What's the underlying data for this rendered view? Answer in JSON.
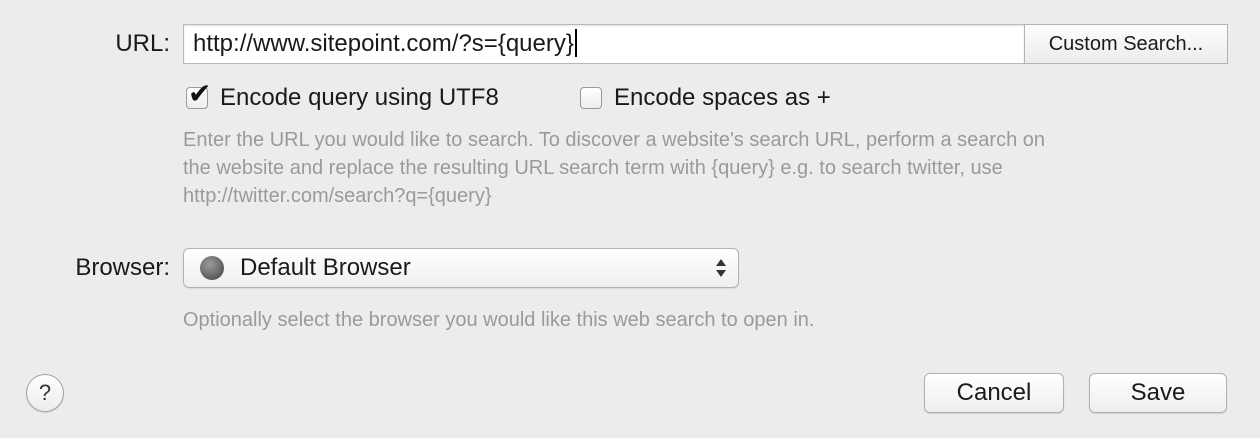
{
  "url_section": {
    "label": "URL:",
    "value": "http://www.sitepoint.com/?s={query}",
    "custom_search_label": "Custom Search...",
    "encode_utf8": {
      "label": "Encode query using UTF8",
      "checked": true
    },
    "encode_spaces": {
      "label": "Encode spaces as +",
      "checked": false
    },
    "help_line1": "Enter the URL you would like to search. To discover a website's search URL, perform a search on",
    "help_line2": "the website and replace the resulting URL search term with {query} e.g. to search twitter, use",
    "help_line3": "http://twitter.com/search?q={query}"
  },
  "browser_section": {
    "label": "Browser:",
    "selected": "Default Browser",
    "selected_icon": "browser-globe-icon",
    "help": "Optionally select the browser you would like this web search to open in."
  },
  "footer": {
    "help_label": "?",
    "cancel_label": "Cancel",
    "save_label": "Save"
  },
  "colors": {
    "background": "#ececec",
    "help_text": "#9a9a9a"
  }
}
